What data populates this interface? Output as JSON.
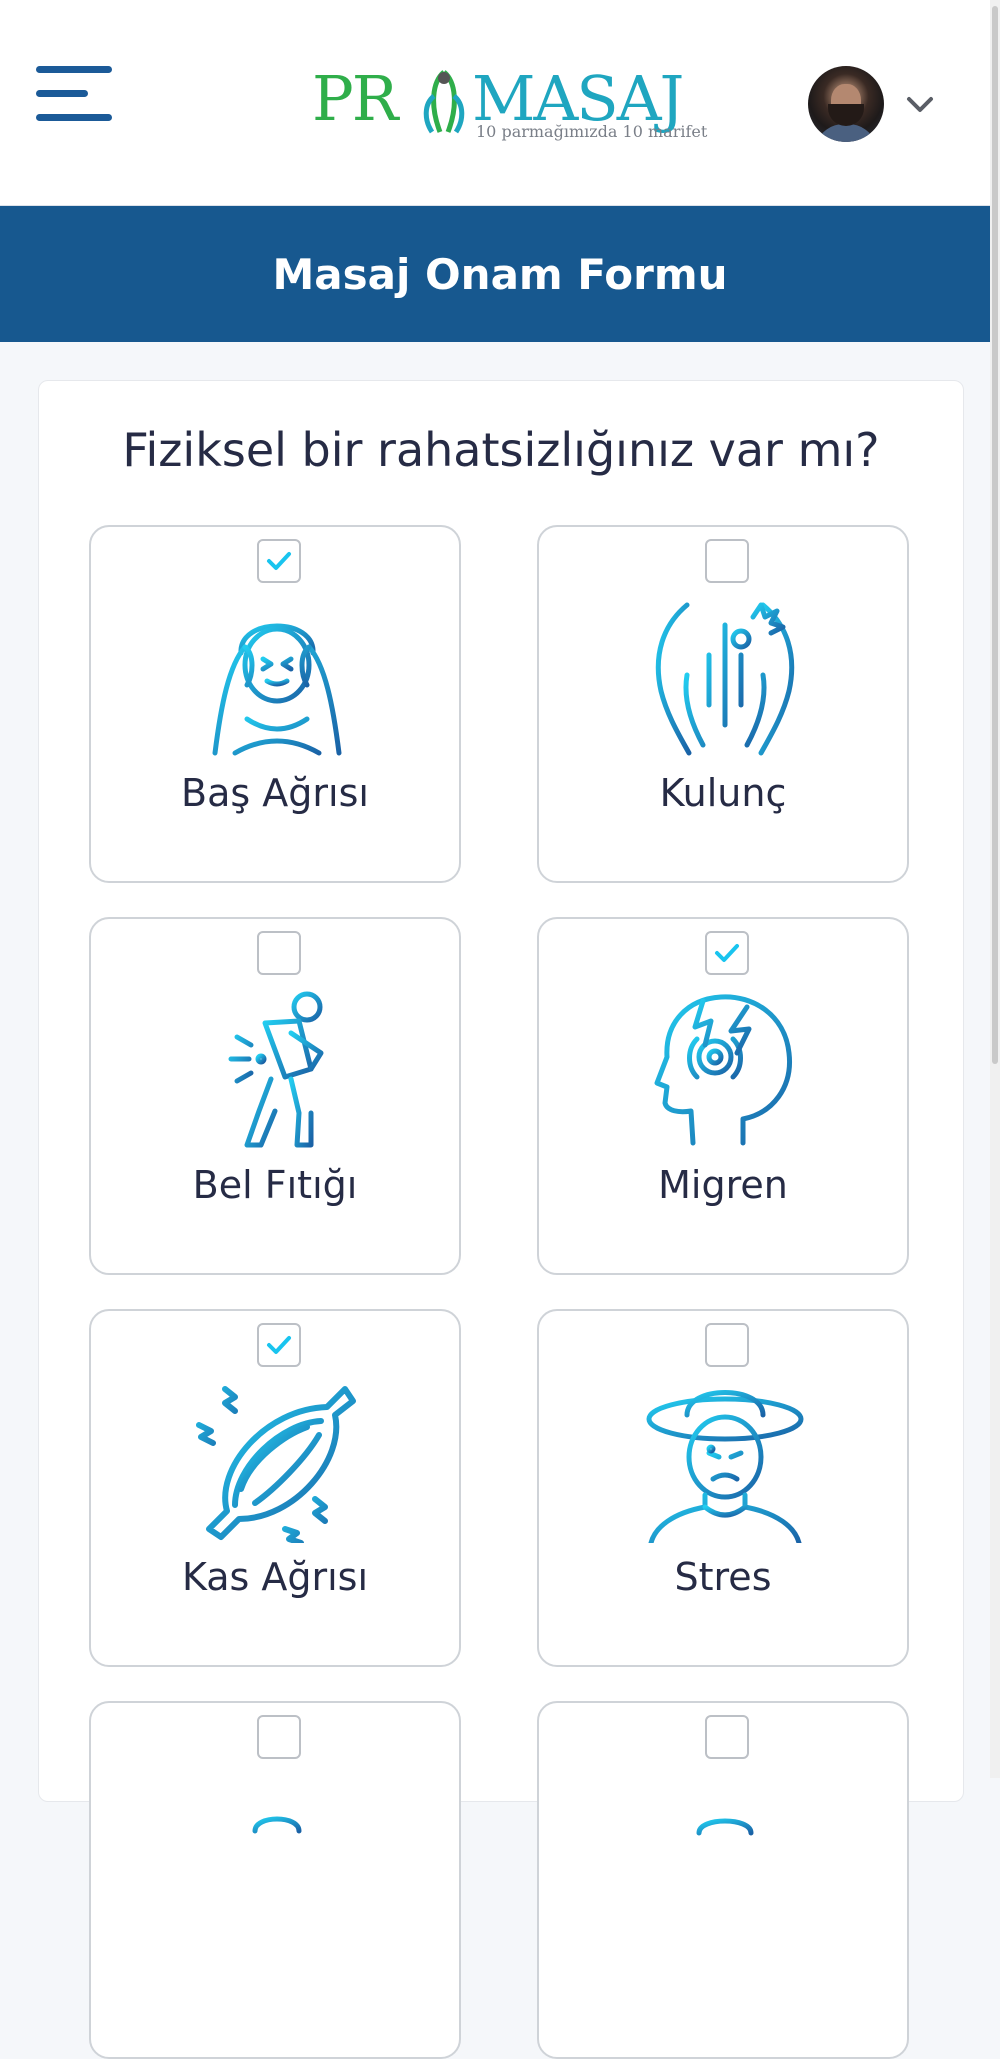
{
  "header": {
    "menu_icon": "hamburger-menu-icon",
    "logo": {
      "left_text": "PR",
      "right_text": "MASAJ",
      "tagline": "10 parmağımızda 10 marifet"
    },
    "avatar_icon": "user-avatar",
    "dropdown_icon": "chevron-down-icon"
  },
  "banner": {
    "title": "Masaj Onam Formu"
  },
  "form": {
    "question": "Fiziksel bir rahatsizlığınız var mı?",
    "options": [
      {
        "label": "Baş Ağrısı",
        "checked": true,
        "icon": "headache-icon"
      },
      {
        "label": "Kulunç",
        "checked": false,
        "icon": "back-pain-icon"
      },
      {
        "label": "Bel Fıtığı",
        "checked": false,
        "icon": "herniated-disc-icon"
      },
      {
        "label": "Migren",
        "checked": true,
        "icon": "migraine-icon"
      },
      {
        "label": "Kas Ağrısı",
        "checked": true,
        "icon": "muscle-pain-icon"
      },
      {
        "label": "Stres",
        "checked": false,
        "icon": "stress-icon"
      },
      {
        "label": "",
        "checked": false,
        "icon": "partial-option-icon"
      },
      {
        "label": "",
        "checked": false,
        "icon": "partial-option-icon"
      }
    ]
  },
  "colors": {
    "brand_blue": "#17588f",
    "icon_cyan": "#1ec6ea",
    "icon_blue": "#1a6fb0",
    "check_cyan": "#19c4ef",
    "logo_green": "#2fae4a",
    "logo_teal": "#1fa6c0"
  }
}
